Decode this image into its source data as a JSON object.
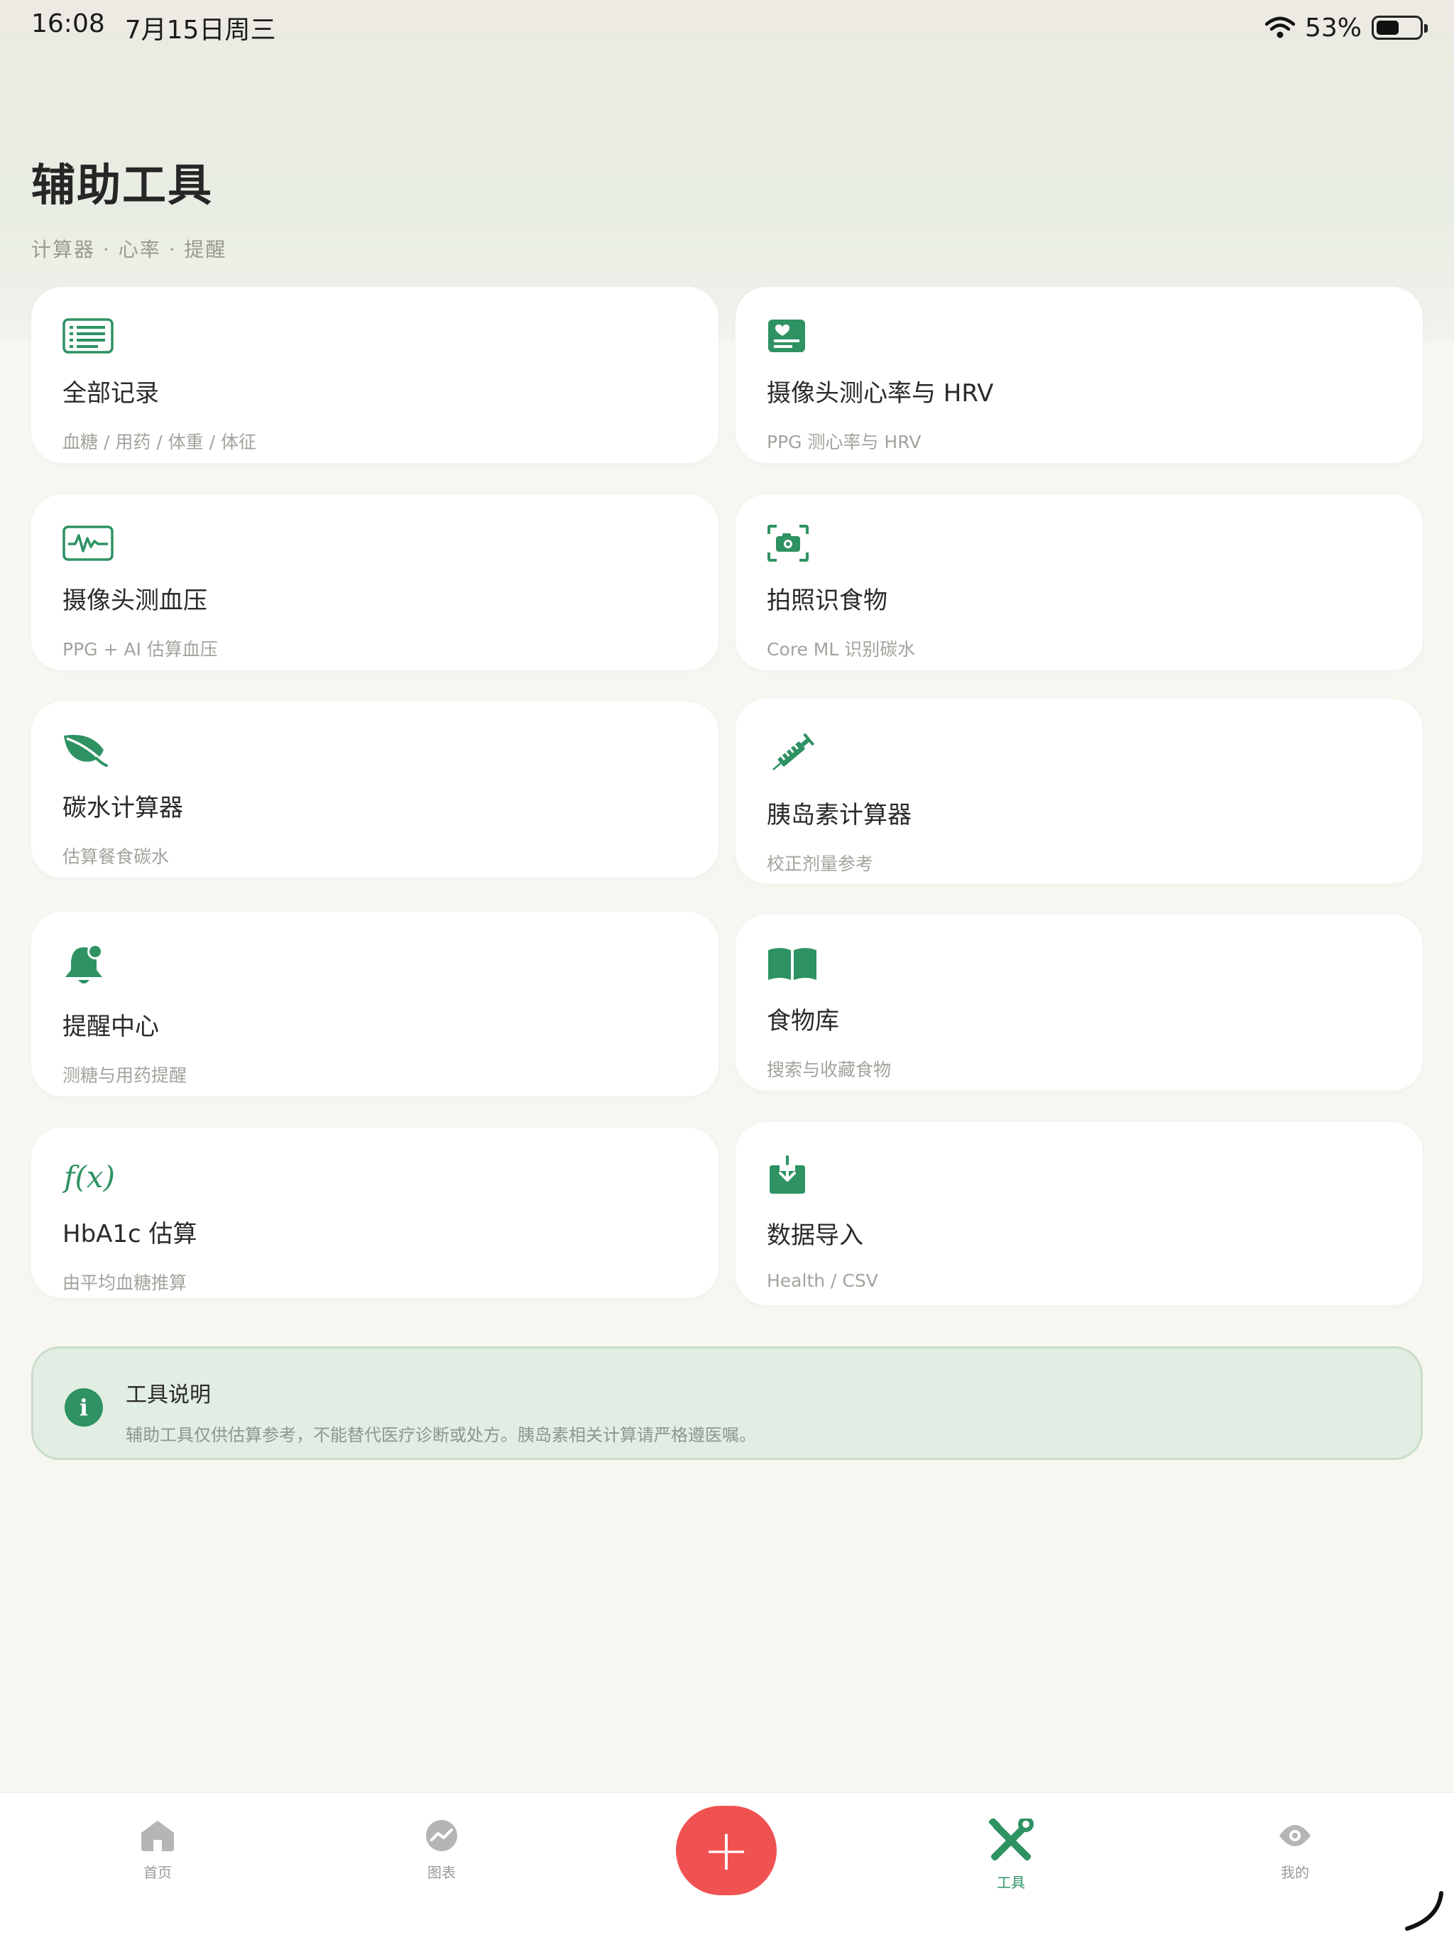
{
  "status": {
    "time": "16:08",
    "date": "7月15日周三",
    "battery": "53%",
    "battery_level": 0.53
  },
  "header": {
    "title": "辅助工具",
    "subtitle": "计算器 · 心率 · 提醒"
  },
  "cards": [
    {
      "icon": "list-icon",
      "title": "全部记录",
      "subtitle": "血糖 / 用药 / 体重 / 体征"
    },
    {
      "icon": "heart-monitor-icon",
      "title": "摄像头测心率与 HRV",
      "subtitle": "PPG 测心率与 HRV"
    },
    {
      "icon": "waveform-icon",
      "title": "摄像头测血压",
      "subtitle": "PPG + AI 估算血压"
    },
    {
      "icon": "camera-icon",
      "title": "拍照识食物",
      "subtitle": "Core ML 识别碳水"
    },
    {
      "icon": "leaf-icon",
      "title": "碳水计算器",
      "subtitle": "估算餐食碳水"
    },
    {
      "icon": "syringe-icon",
      "title": "胰岛素计算器",
      "subtitle": "校正剂量参考"
    },
    {
      "icon": "bell-icon",
      "title": "提醒中心",
      "subtitle": "测糖与用药提醒"
    },
    {
      "icon": "book-icon",
      "title": "食物库",
      "subtitle": "搜索与收藏食物"
    },
    {
      "icon": "function-icon",
      "title": "HbA1c 估算",
      "subtitle": "由平均血糖推算"
    },
    {
      "icon": "download-icon",
      "title": "数据导入",
      "subtitle": "Health / CSV"
    }
  ],
  "notice": {
    "icon_letter": "i",
    "title": "工具说明",
    "text": "辅助工具仅供估算参考，不能替代医疗诊断或处方。胰岛素相关计算请严格遵医嘱。"
  },
  "tabs": {
    "home": "首页",
    "charts": "图表",
    "add": "+",
    "tools": "工具",
    "mine": "我的"
  },
  "colors": {
    "accent": "#2e9263",
    "fab": "#f05252",
    "background": "#f8f6f0"
  }
}
